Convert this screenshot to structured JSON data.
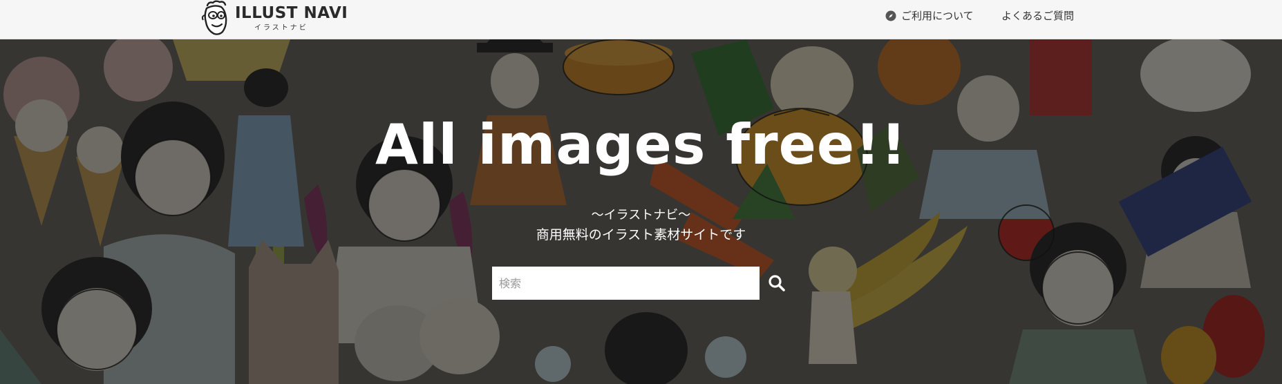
{
  "header": {
    "logo_title": "ILLUST NAVI",
    "logo_sub": "イラストナビ",
    "nav": {
      "about_label": "ご利用について",
      "faq_label": "よくあるご質問"
    }
  },
  "hero": {
    "title": "All images free!!",
    "subtitle_line1": "〜イラストナビ〜",
    "subtitle_line2": "商用無料のイラスト素材サイトです",
    "search": {
      "placeholder": "検索",
      "value": ""
    }
  },
  "icons": {
    "logo": "monkey-face-logo-icon",
    "about": "compass-icon",
    "search": "search-icon"
  },
  "colors": {
    "header_bg": "#f6f6f6",
    "nav_text": "#333333",
    "hero_text": "#ffffff"
  }
}
